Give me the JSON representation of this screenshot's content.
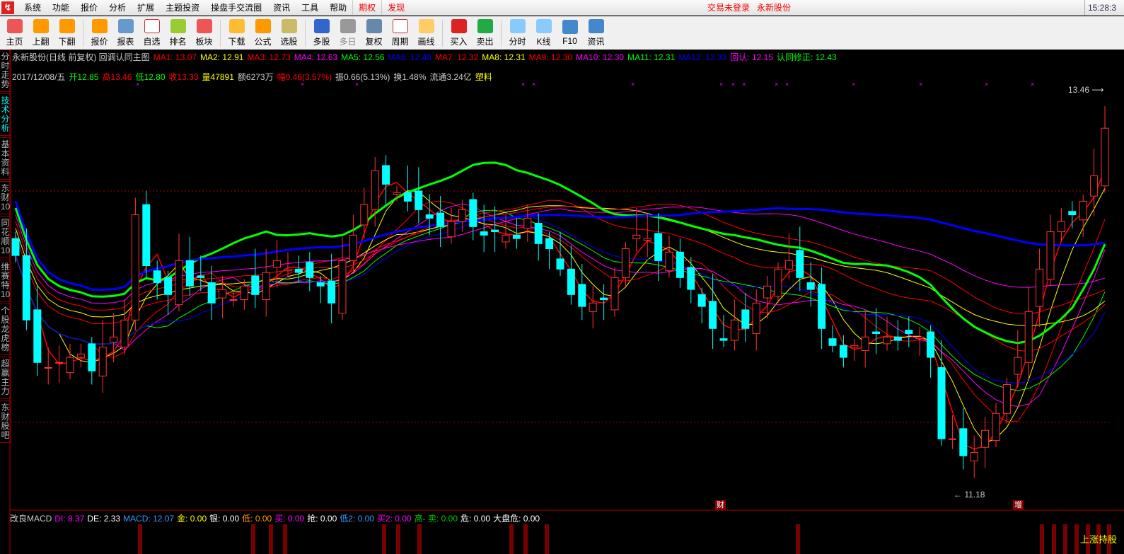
{
  "menu": {
    "items": [
      "系统",
      "功能",
      "报价",
      "分析",
      "扩展",
      "主题投资",
      "操盘手交流圈",
      "资讯",
      "工具",
      "帮助"
    ],
    "red_items": [
      "期权",
      "发现"
    ],
    "status": "交易未登录",
    "broker": "永新股份",
    "clock": "15:28:3"
  },
  "toolbar": [
    {
      "label": "主页",
      "icon": "home-icon",
      "color": "#e55"
    },
    {
      "label": "上翻",
      "icon": "arrow-up-icon",
      "color": "#f90"
    },
    {
      "label": "下翻",
      "icon": "arrow-down-icon",
      "color": "#f90"
    },
    {
      "label": "报价",
      "icon": "yen-icon",
      "color": "#f90",
      "sep": true
    },
    {
      "label": "报表",
      "icon": "report-icon",
      "color": "#69c"
    },
    {
      "label": "自选",
      "icon": "f6-icon",
      "color": "#fff"
    },
    {
      "label": "排名",
      "icon": "sort-icon",
      "color": "#9c3"
    },
    {
      "label": "板块",
      "icon": "blocks-icon",
      "color": "#e55"
    },
    {
      "label": "下载",
      "icon": "download-icon",
      "color": "#fb3",
      "sep": true
    },
    {
      "label": "公式",
      "icon": "formula-icon",
      "color": "#f90"
    },
    {
      "label": "选股",
      "icon": "star-icon",
      "color": "#cb6"
    },
    {
      "label": "多股",
      "icon": "multi-stock-icon",
      "color": "#36c",
      "sep": true
    },
    {
      "label": "多日",
      "icon": "clock-icon",
      "color": "#999",
      "disabled": true
    },
    {
      "label": "复权",
      "icon": "restore-icon",
      "color": "#68a"
    },
    {
      "label": "周期",
      "icon": "f8-icon",
      "color": "#fff"
    },
    {
      "label": "画线",
      "icon": "draw-icon",
      "color": "#fc6"
    },
    {
      "label": "买入",
      "icon": "buy-icon",
      "color": "#d22",
      "sep": true
    },
    {
      "label": "卖出",
      "icon": "sell-icon",
      "color": "#2a4"
    },
    {
      "label": "分时",
      "icon": "intraday-icon",
      "color": "#8cf",
      "sep": true
    },
    {
      "label": "K线",
      "icon": "kline-icon",
      "color": "#8cf"
    },
    {
      "label": "F10",
      "icon": "f10-icon",
      "color": "#48c"
    },
    {
      "label": "资讯",
      "icon": "news-icon",
      "color": "#48c"
    }
  ],
  "side_tabs": [
    "分时走势",
    "技术分析",
    "基本资料",
    "东财10",
    "同花顺10",
    "维赛特10",
    "个股龙虎榜",
    "超赢主力",
    "东财股吧"
  ],
  "active_side_tab": 1,
  "info1": [
    {
      "t": "永新股份(日线 前复权) 回调认同主图",
      "c": "#ccc"
    },
    {
      "t": "MA1: 13.07",
      "c": "#f00"
    },
    {
      "t": "MA2: 12.91",
      "c": "#ff0"
    },
    {
      "t": "MA3: 12.73",
      "c": "#f00"
    },
    {
      "t": "MA4: 12.63",
      "c": "#f0f"
    },
    {
      "t": "MA5: 12.56",
      "c": "#0f0"
    },
    {
      "t": "MA6: 12.48",
      "c": "#00f"
    },
    {
      "t": "MA7: 12.32",
      "c": "#f00"
    },
    {
      "t": "MA8: 12.31",
      "c": "#ff0"
    },
    {
      "t": "MA9: 12.30",
      "c": "#f00"
    },
    {
      "t": "MA10: 12.30",
      "c": "#f0f"
    },
    {
      "t": "MA11: 12.31",
      "c": "#0f0"
    },
    {
      "t": "MA12: 12.33",
      "c": "#00f"
    },
    {
      "t": "回认: 12.15",
      "c": "#f0f"
    },
    {
      "t": "认同修正: 12.43",
      "c": "#0f0"
    }
  ],
  "info2": [
    {
      "t": "2017/12/08/五",
      "c": "#ccc"
    },
    {
      "t": "开12.85",
      "c": "#0f0"
    },
    {
      "t": "高13.46",
      "c": "#f00"
    },
    {
      "t": "低12.80",
      "c": "#0f0"
    },
    {
      "t": "收13.33",
      "c": "#f00"
    },
    {
      "t": "量47891",
      "c": "#ff0"
    },
    {
      "t": "额6273万",
      "c": "#ccc"
    },
    {
      "t": "幅0.46(3.57%)",
      "c": "#f00"
    },
    {
      "t": "振0.66(5.13%)",
      "c": "#ccc"
    },
    {
      "t": "换1.48%",
      "c": "#ccc"
    },
    {
      "t": "流通3.24亿",
      "c": "#ccc"
    },
    {
      "t": "塑料",
      "c": "#ff0"
    }
  ],
  "indicator": [
    {
      "t": "改良MACD",
      "c": "#ccc"
    },
    {
      "t": "DI: 8.37",
      "c": "#f0f"
    },
    {
      "t": "DE: 2.33",
      "c": "#fff"
    },
    {
      "t": "MACD: 12.07",
      "c": "#39f"
    },
    {
      "t": "金: 0.00",
      "c": "#ff0"
    },
    {
      "t": "银: 0.00",
      "c": "#fff"
    },
    {
      "t": "低: 0.00",
      "c": "#f90"
    },
    {
      "t": "买: 0.00",
      "c": "#f0f"
    },
    {
      "t": "抢: 0.00",
      "c": "#fff"
    },
    {
      "t": "低2: 0.00",
      "c": "#39f"
    },
    {
      "t": "买2: 0.00",
      "c": "#f0f"
    },
    {
      "t": "高- 卖: 0.00",
      "c": "#0c0"
    },
    {
      "t": "危: 0.00",
      "c": "#fff"
    },
    {
      "t": "大盘危: 0.00",
      "c": "#fff"
    }
  ],
  "tags": {
    "cai": "财",
    "zeng": "增",
    "bottom_right": "上涨持股"
  },
  "chart_data": {
    "type": "candlestick",
    "high_label": "13.46",
    "low_label": "11.18",
    "price_range": [
      11.18,
      13.46
    ],
    "closes": [
      12.58,
      12.2,
      11.95,
      11.92,
      11.95,
      11.98,
      12.0,
      11.9,
      12.04,
      12.1,
      12.2,
      12.82,
      12.52,
      12.42,
      12.35,
      12.55,
      12.4,
      12.45,
      12.3,
      12.38,
      12.32,
      12.4,
      12.35,
      12.48,
      12.55,
      12.5,
      12.48,
      12.45,
      12.4,
      12.3,
      12.55,
      12.7,
      12.88,
      13.08,
      13.0,
      12.95,
      12.9,
      12.85,
      12.8,
      12.75,
      12.78,
      12.85,
      12.75,
      12.7,
      12.72,
      12.7,
      12.68,
      12.8,
      12.65,
      12.62,
      12.5,
      12.35,
      12.28,
      12.3,
      12.32,
      12.45,
      12.62,
      12.7,
      12.68,
      12.55,
      12.6,
      12.45,
      12.38,
      12.28,
      12.15,
      12.08,
      12.2,
      12.15,
      12.3,
      12.4,
      12.5,
      12.55,
      12.45,
      12.38,
      12.15,
      12.05,
      11.98,
      12.05,
      12.1,
      12.12,
      12.1,
      12.08,
      12.12,
      12.1,
      11.98,
      11.5,
      11.5,
      11.4,
      11.42,
      11.55,
      11.65,
      11.82,
      11.98,
      12.25,
      12.5,
      12.72,
      12.78,
      12.82,
      12.9,
      13.05,
      13.33
    ],
    "ma_colors": [
      "#f00",
      "#ff0",
      "#f00",
      "#f0f",
      "#0f0",
      "#00f",
      "#f00",
      "#ff0",
      "#f00",
      "#f0f",
      "#0f0",
      "#00f"
    ]
  }
}
